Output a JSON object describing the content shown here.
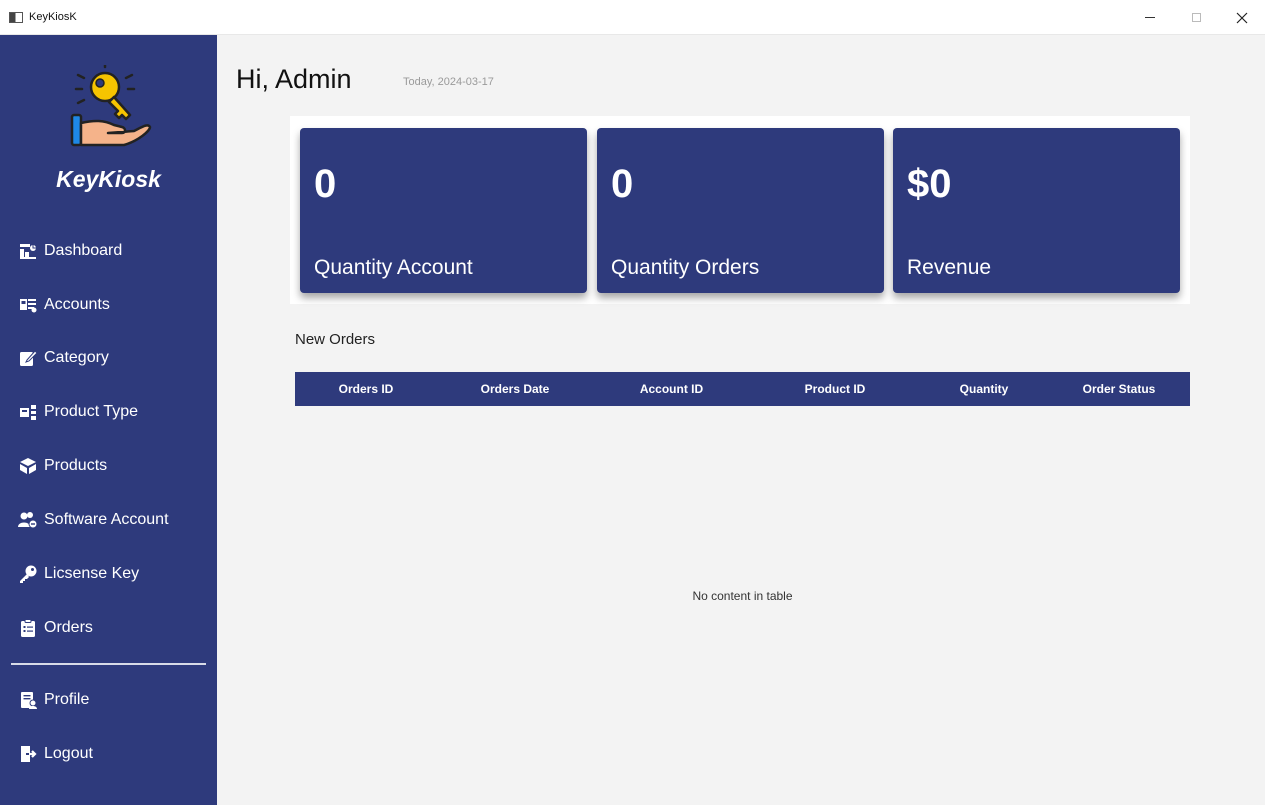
{
  "window": {
    "title": "KeyKiosK"
  },
  "brand": {
    "name": "KeyKiosk"
  },
  "sidebar": {
    "items": [
      {
        "label": "Dashboard",
        "icon": "dashboard-icon"
      },
      {
        "label": "Accounts",
        "icon": "accounts-icon"
      },
      {
        "label": "Category",
        "icon": "edit-icon"
      },
      {
        "label": "Product Type",
        "icon": "product-type-icon"
      },
      {
        "label": "Products",
        "icon": "box-icon"
      },
      {
        "label": "Software Account",
        "icon": "users-icon"
      },
      {
        "label": "Licsense Key",
        "icon": "key-icon"
      },
      {
        "label": "Orders",
        "icon": "clipboard-icon"
      }
    ],
    "bottom_items": [
      {
        "label": "Profile",
        "icon": "profile-icon"
      },
      {
        "label": "Logout",
        "icon": "logout-icon"
      }
    ]
  },
  "header": {
    "greeting": "Hi, Admin",
    "date": "Today, 2024-03-17"
  },
  "stats": [
    {
      "value": "0",
      "label": "Quantity Account"
    },
    {
      "value": "0",
      "label": "Quantity Orders"
    },
    {
      "value": "$0",
      "label": "Revenue"
    }
  ],
  "orders": {
    "title": "New Orders",
    "columns": [
      "Orders ID",
      "Orders Date",
      "Account ID",
      "Product ID",
      "Quantity",
      "Order Status"
    ],
    "empty_message": "No content in table"
  },
  "colors": {
    "primary": "#2e3a7c",
    "background": "#f3f3f3"
  }
}
